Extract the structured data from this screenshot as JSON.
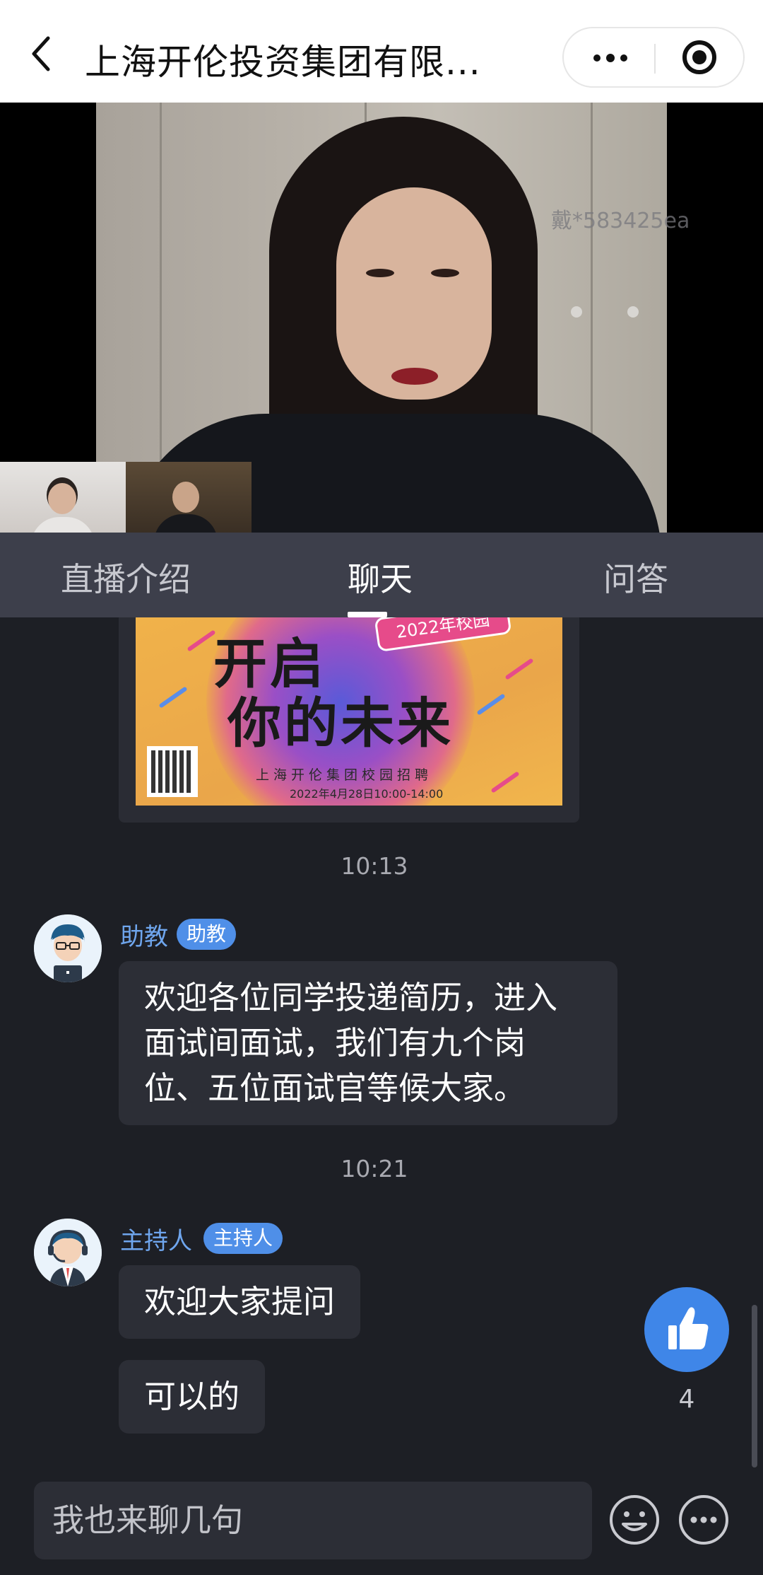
{
  "header": {
    "title": "上海开伦投资集团有限...",
    "back_icon": "chevron-left-icon",
    "more_icon": "more-dots-icon",
    "close_icon": "target-close-icon"
  },
  "video": {
    "watermark": "戴*583425ea"
  },
  "tabs": [
    {
      "label": "直播介绍",
      "active": false
    },
    {
      "label": "聊天",
      "active": true
    },
    {
      "label": "问答",
      "active": false
    }
  ],
  "poster": {
    "year_tag": "2022年校园",
    "headline_1": "开启",
    "headline_2": "你的未来",
    "subtitle": "上海开伦集团校园招聘",
    "date": "2022年4月28日10:00-14:00"
  },
  "chat": {
    "time_1": "10:13",
    "msg1": {
      "sender": "助教",
      "badge": "助教",
      "line_1": "欢迎各位同学投递简历，进入",
      "line_2": "面试间面试，我们有九个岗",
      "line_3": "位、五位面试官等候大家。"
    },
    "time_2": "10:21",
    "msg2": {
      "sender": "主持人",
      "badge": "主持人",
      "text_1": "欢迎大家提问",
      "text_2": "可以的"
    }
  },
  "like": {
    "count": "4",
    "icon": "thumbs-up-icon"
  },
  "input": {
    "placeholder": "我也来聊几句",
    "emoji_icon": "smiley-icon",
    "more_icon": "more-circle-icon"
  },
  "colors": {
    "background": "#1d1f25",
    "tab_bar": "#3d3f4b",
    "accent_blue": "#4f8fe8",
    "bubble": "#2c2e36"
  }
}
